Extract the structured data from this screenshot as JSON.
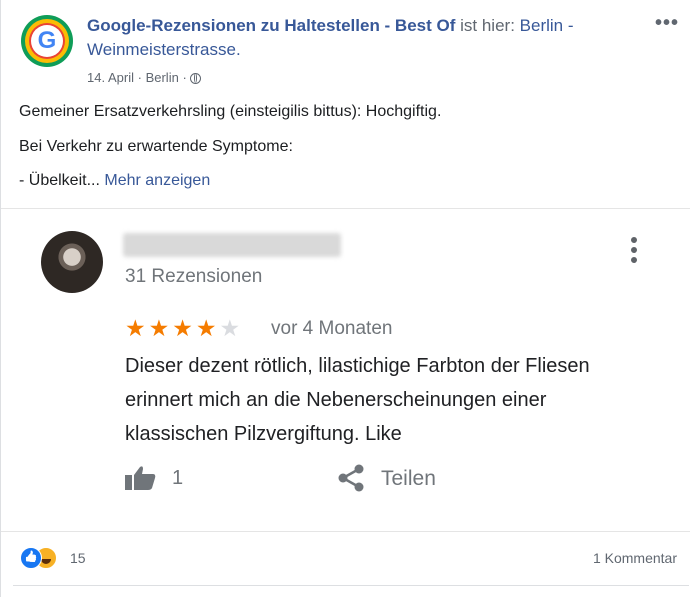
{
  "header": {
    "page_name": "Google-Rezensionen zu Haltestellen - Best Of",
    "is_here": "ist hier:",
    "location": "Berlin - Weinmeisterstrasse.",
    "date": "14. April",
    "place": "Berlin",
    "separator": "·"
  },
  "body": {
    "line1": "Gemeiner Ersatzverkehrsling (einsteigilis bittus): Hochgiftig.",
    "line2": "Bei Verkehr zu erwartende Symptome:",
    "line3": "- Übelkeit...",
    "more_link": "Mehr anzeigen"
  },
  "review": {
    "review_count": "31 Rezensionen",
    "rating": 4,
    "rating_max": 5,
    "age": "vor 4 Monaten",
    "text": "Dieser dezent rötlich, lilastichige Farbton der Fliesen erinnert mich an die  Nebenerscheinungen einer klassischen Pilzvergiftung. Like",
    "likes": "1",
    "share_label": "Teilen",
    "star_color": "#f57c00"
  },
  "footer": {
    "reaction_count": "15",
    "comment_count": "1 Kommentar"
  }
}
